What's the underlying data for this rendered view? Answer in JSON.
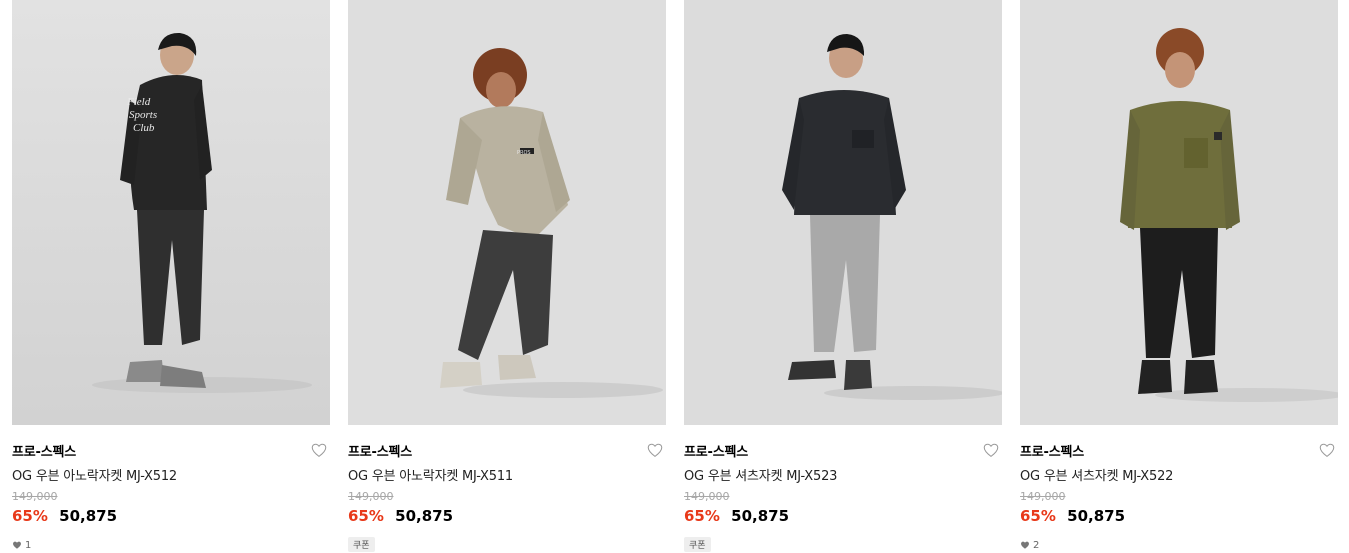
{
  "products": [
    {
      "brand": "프로-스펙스",
      "name": "OG 우븐 아노락자켓 MJ-X512",
      "original_price": "149,000",
      "discount": "65%",
      "price": "50,875",
      "likes": "1",
      "coupon": ""
    },
    {
      "brand": "프로-스펙스",
      "name": "OG 우븐 아노락자켓 MJ-X511",
      "original_price": "149,000",
      "discount": "65%",
      "price": "50,875",
      "likes": "",
      "coupon": "쿠폰"
    },
    {
      "brand": "프로-스펙스",
      "name": "OG 우븐 셔츠자켓 MJ-X523",
      "original_price": "149,000",
      "discount": "65%",
      "price": "50,875",
      "likes": "",
      "coupon": "쿠폰"
    },
    {
      "brand": "프로-스펙스",
      "name": "OG 우븐 셔츠자켓 MJ-X522",
      "original_price": "149,000",
      "discount": "65%",
      "price": "50,875",
      "likes": "2",
      "coupon": ""
    }
  ],
  "icons": {
    "like": "heart-outline-icon",
    "like_count": "heart-filled-icon"
  },
  "colors": {
    "discount": "#e8391a",
    "image_bg": "#dcdcdc"
  },
  "image_text": {
    "jacket_back_print": "Field Sports Club",
    "jacket_chest_print": "PROS"
  }
}
